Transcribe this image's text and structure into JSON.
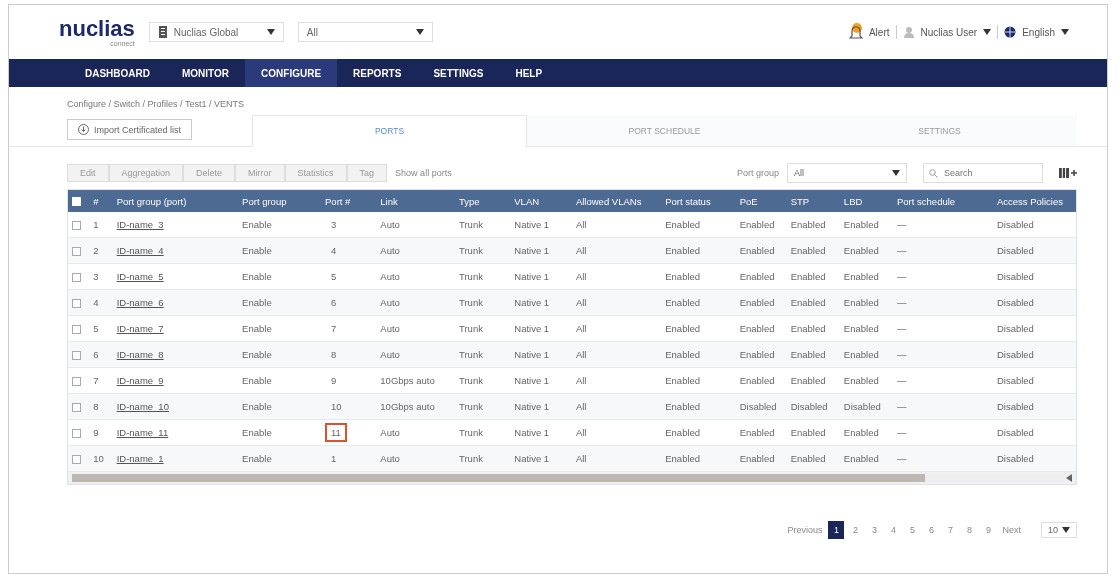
{
  "header": {
    "logo": "nuclias",
    "logo_sub": "connect",
    "organization": "Nuclias Global",
    "site": "All",
    "notifications": "Alert",
    "user": "Nuclias User",
    "language": "English"
  },
  "nav": [
    {
      "label": "DASHBOARD",
      "selected": false
    },
    {
      "label": "MONITOR",
      "selected": false
    },
    {
      "label": "CONFIGURE",
      "selected": true
    },
    {
      "label": "REPORTS",
      "selected": false
    },
    {
      "label": "SETTINGS",
      "selected": false
    },
    {
      "label": "HELP",
      "selected": false
    }
  ],
  "breadcrumb": "Configure / Switch / Profiles / Test1 / VENTS",
  "import_button": "Import Certificated list",
  "tabs": [
    {
      "label": "PORTS",
      "selected": true
    },
    {
      "label": "PORT SCHEDULE",
      "selected": false
    },
    {
      "label": "SETTINGS",
      "selected": false
    }
  ],
  "toolbar": {
    "buttons": [
      "Edit",
      "Aggregation",
      "Delete",
      "Mirror",
      "Statistics",
      "Tag"
    ],
    "show_all": "Show all ports",
    "port_group_label": "Port group",
    "port_group_value": "All",
    "search_placeholder": "Search"
  },
  "table": {
    "columns": [
      "#",
      "Port group (port)",
      "Port group",
      "Port #",
      "Link",
      "Type",
      "VLAN",
      "Allowed VLANs",
      "Port status",
      "PoE",
      "STP",
      "LBD",
      "Port schedule",
      "Access Policies"
    ],
    "header_checked": false,
    "rows": [
      {
        "checked": false,
        "highlighted": false,
        "cells": [
          "1",
          "ID-name_3",
          "Enable",
          "3",
          "Auto",
          "Trunk",
          "Native 1",
          "All",
          "Enabled",
          "Enabled",
          "Enabled",
          "Enabled",
          "—",
          "Disabled"
        ]
      },
      {
        "checked": false,
        "highlighted": false,
        "cells": [
          "2",
          "ID-name_4",
          "Enable",
          "4",
          "Auto",
          "Trunk",
          "Native 1",
          "All",
          "Enabled",
          "Enabled",
          "Enabled",
          "Enabled",
          "—",
          "Disabled"
        ]
      },
      {
        "checked": false,
        "highlighted": false,
        "cells": [
          "3",
          "ID-name_5",
          "Enable",
          "5",
          "Auto",
          "Trunk",
          "Native 1",
          "All",
          "Enabled",
          "Enabled",
          "Enabled",
          "Enabled",
          "—",
          "Disabled"
        ]
      },
      {
        "checked": false,
        "highlighted": false,
        "cells": [
          "4",
          "ID-name_6",
          "Enable",
          "6",
          "Auto",
          "Trunk",
          "Native 1",
          "All",
          "Enabled",
          "Enabled",
          "Enabled",
          "Enabled",
          "—",
          "Disabled"
        ]
      },
      {
        "checked": false,
        "highlighted": false,
        "cells": [
          "5",
          "ID-name_7",
          "Enable",
          "7",
          "Auto",
          "Trunk",
          "Native 1",
          "All",
          "Enabled",
          "Enabled",
          "Enabled",
          "Enabled",
          "—",
          "Disabled"
        ]
      },
      {
        "checked": false,
        "highlighted": false,
        "cells": [
          "6",
          "ID-name_8",
          "Enable",
          "8",
          "Auto",
          "Trunk",
          "Native 1",
          "All",
          "Enabled",
          "Enabled",
          "Enabled",
          "Enabled",
          "—",
          "Disabled"
        ]
      },
      {
        "checked": false,
        "highlighted": false,
        "cells": [
          "7",
          "ID-name_9",
          "Enable",
          "9",
          "10Gbps auto",
          "Trunk",
          "Native 1",
          "All",
          "Enabled",
          "Enabled",
          "Enabled",
          "Enabled",
          "—",
          "Disabled"
        ]
      },
      {
        "checked": false,
        "highlighted": false,
        "cells": [
          "8",
          "ID-name_10",
          "Enable",
          "10",
          "10Gbps auto",
          "Trunk",
          "Native 1",
          "All",
          "Enabled",
          "Disabled",
          "Disabled",
          "Disabled",
          "—",
          "Disabled"
        ]
      },
      {
        "checked": false,
        "highlighted": true,
        "cells": [
          "9",
          "ID-name_11",
          "Enable",
          "11",
          "Auto",
          "Trunk",
          "Native 1",
          "All",
          "Enabled",
          "Enabled",
          "Enabled",
          "Enabled",
          "—",
          "Disabled"
        ]
      },
      {
        "checked": false,
        "highlighted": false,
        "cells": [
          "10",
          "ID-name_1",
          "Enable",
          "1",
          "Auto",
          "Trunk",
          "Native 1",
          "All",
          "Enabled",
          "Enabled",
          "Enabled",
          "Enabled",
          "—",
          "Disabled"
        ]
      }
    ]
  },
  "pagination": {
    "previous": "Previous",
    "pages": [
      {
        "label": "1",
        "selected": true
      },
      {
        "label": "2",
        "selected": false
      },
      {
        "label": "3",
        "selected": false
      },
      {
        "label": "4",
        "selected": false
      },
      {
        "label": "5",
        "selected": false
      },
      {
        "label": "6",
        "selected": false
      },
      {
        "label": "7",
        "selected": false
      },
      {
        "label": "8",
        "selected": false
      },
      {
        "label": "9",
        "selected": false
      }
    ],
    "next": "Next",
    "page_size": "10"
  }
}
